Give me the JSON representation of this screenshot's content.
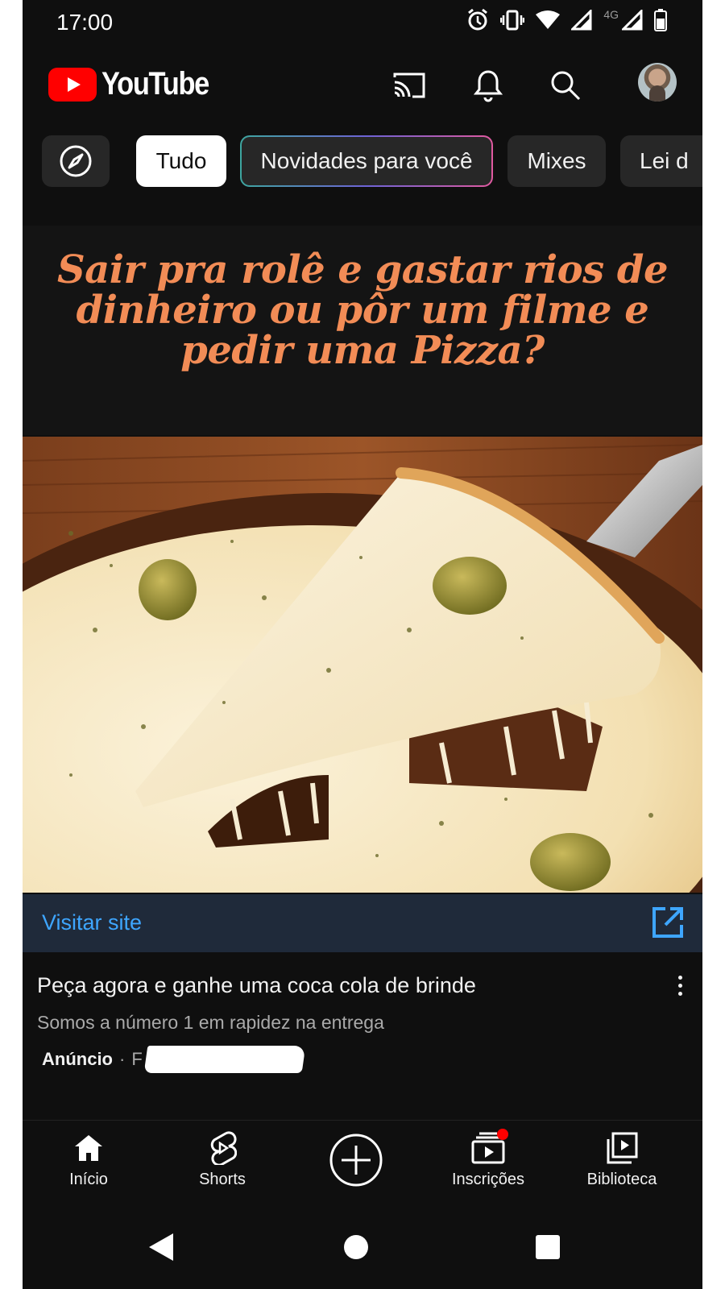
{
  "status_bar": {
    "time": "17:00",
    "network_label": "4G",
    "icons": [
      "alarm-icon",
      "vibrate-icon",
      "wifi-icon",
      "signal-icon",
      "battery-icon"
    ]
  },
  "header": {
    "app_name": "YouTube",
    "icons": [
      "cast-icon",
      "bell-icon",
      "search-icon",
      "avatar"
    ]
  },
  "chips": [
    {
      "label": "",
      "icon": "compass-icon"
    },
    {
      "label": "Tudo",
      "active": true
    },
    {
      "label": "Novidades para você"
    },
    {
      "label": "Mixes"
    },
    {
      "label": "Lei d"
    }
  ],
  "ad": {
    "headline": "Sair pra rolê e gastar rios de dinheiro ou pôr um filme e pedir uma Pizza?",
    "visit_label": "Visitar site",
    "title": "Peça agora e ganhe uma coca cola de brinde",
    "description": "Somos a número 1 em rapidez na entrega",
    "badge": "Anúncio",
    "separator": "·",
    "advertiser": "F"
  },
  "bottom_nav": [
    {
      "label": "Início",
      "icon": "home-icon"
    },
    {
      "label": "Shorts",
      "icon": "shorts-icon"
    },
    {
      "label": "",
      "icon": "create-plus-icon"
    },
    {
      "label": "Inscrições",
      "icon": "subscriptions-icon"
    },
    {
      "label": "Biblioteca",
      "icon": "library-icon"
    }
  ],
  "colors": {
    "background": "#0f0f0f",
    "accent_red": "#ff0000",
    "link_blue": "#3ea6ff",
    "headline_orange": "#f28c56"
  }
}
